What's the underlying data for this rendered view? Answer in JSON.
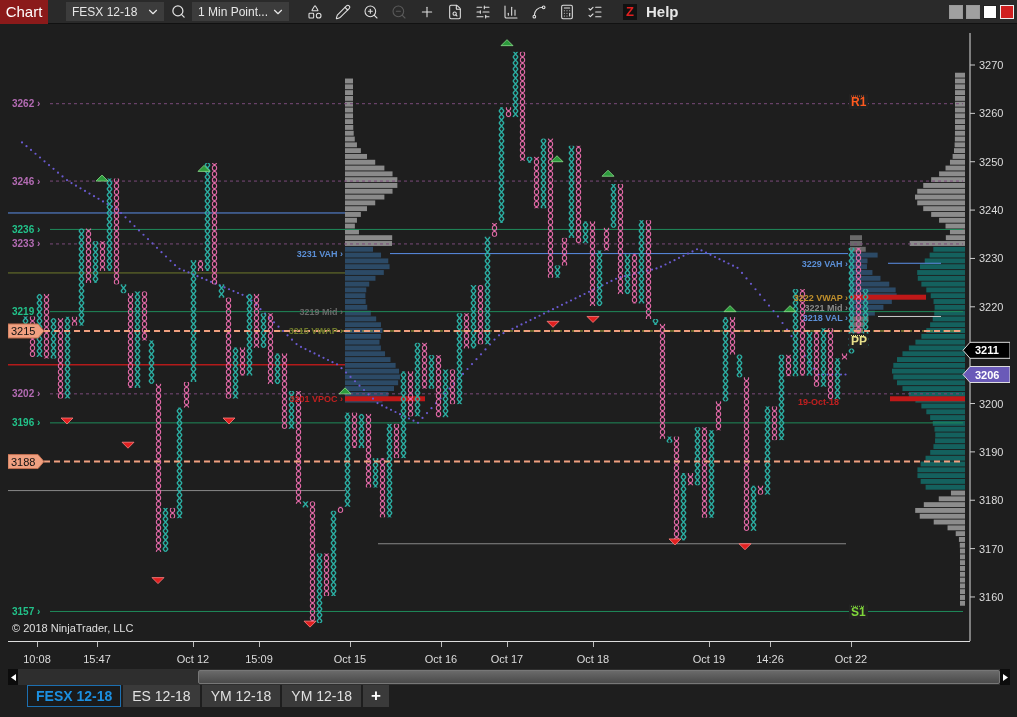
{
  "toolbar": {
    "title": "Chart",
    "instrument": "FESX 12-18",
    "interval": "1 Min Point...",
    "tools": [
      {
        "kind": "objects",
        "disabled": false
      },
      {
        "kind": "pencil",
        "disabled": false
      },
      {
        "kind": "zoom-in",
        "disabled": false
      },
      {
        "kind": "zoom-out",
        "disabled": true
      },
      {
        "kind": "crosshair",
        "disabled": false
      },
      {
        "kind": "data-box",
        "disabled": false
      },
      {
        "kind": "properties",
        "disabled": false
      },
      {
        "kind": "bars",
        "disabled": false
      },
      {
        "kind": "strategy",
        "disabled": false
      },
      {
        "kind": "template",
        "disabled": false
      },
      {
        "kind": "list",
        "disabled": false
      }
    ],
    "z_label": "Z",
    "help": "Help"
  },
  "level_labels": [
    {
      "text": "3262 ›",
      "color": "#b36bb3"
    },
    {
      "text": "3246 ›",
      "color": "#b36bb3"
    },
    {
      "text": "3236 ›",
      "color": "#22c28a"
    },
    {
      "text": "3233 ›",
      "color": "#b36bb3"
    },
    {
      "text": "3219 ›",
      "color": "#22c28a"
    },
    {
      "text": "3202 ›",
      "color": "#b36bb3"
    },
    {
      "text": "3196 ›",
      "color": "#22c28a"
    },
    {
      "text": "3157 ›",
      "color": "#22c28a"
    }
  ],
  "price_tags": [
    {
      "text": "3215"
    },
    {
      "text": "3188"
    }
  ],
  "study_labels": [
    {
      "text": "3231 VAH ›",
      "kind": "prior",
      "color": "#5b8fd6"
    },
    {
      "text": "3219 Mid ›",
      "kind": "prior",
      "color": "#6a6a6a"
    },
    {
      "text": "3215 VWAP ›",
      "kind": "prior",
      "color": "#6f7a2c"
    },
    {
      "text": "3201 VPOC ›",
      "kind": "prior",
      "color": "#c02020"
    },
    {
      "text": "3229 VAH ›",
      "kind": "current",
      "color": "#5b8fd6"
    },
    {
      "text": "3222 VWAP ›",
      "kind": "current",
      "color": "#c0902c"
    },
    {
      "text": "3221 Mid ›",
      "kind": "current",
      "color": "#8a8a8a"
    },
    {
      "text": "3218 VAL ›",
      "kind": "current",
      "color": "#5b8fd6"
    },
    {
      "text": "19-Oct-18",
      "kind": "naked",
      "color": "#c02020"
    }
  ],
  "pivot_labels": [
    {
      "text": "R1",
      "color": "#ff5a1f"
    },
    {
      "text": "PP",
      "color": "#e8e08a"
    },
    {
      "text": "S1",
      "color": "#7fd63a"
    }
  ],
  "copyright": "© 2018 NinjaTrader, LLC",
  "price_axis": [
    "3270",
    "3260",
    "3250",
    "3240",
    "3230",
    "3220",
    "3200",
    "3190",
    "3180",
    "3170",
    "3160"
  ],
  "price_markers": [
    {
      "text": "3211",
      "kind": "last"
    },
    {
      "text": "3206",
      "kind": "average"
    }
  ],
  "time_axis": [
    "10:08",
    "15:47",
    "Oct 12",
    "15:09",
    "Oct 15",
    "Oct 16",
    "Oct 17",
    "Oct 18",
    "Oct 19",
    "14:26",
    "Oct 22"
  ],
  "tabs": [
    {
      "label": "FESX 12-18",
      "selected": true
    },
    {
      "label": "ES 12-18",
      "selected": false
    },
    {
      "label": "YM 12-18",
      "selected": false
    },
    {
      "label": "YM 12-18",
      "selected": false
    }
  ],
  "add_tab": "+"
}
